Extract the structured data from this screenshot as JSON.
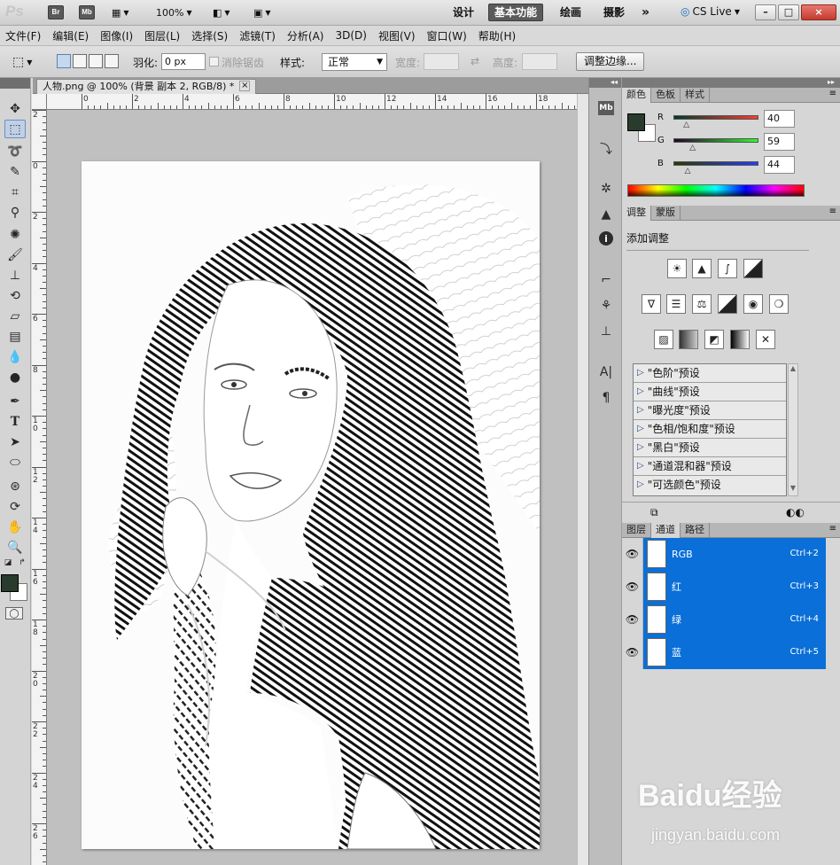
{
  "appbar": {
    "logo": "Ps",
    "badges": [
      "Br",
      "Mb"
    ],
    "zoom": "100%",
    "workspaces": [
      "设计",
      "基本功能",
      "绘画",
      "摄影"
    ],
    "active_workspace": "基本功能",
    "more": "»",
    "cslive": "CS Live",
    "window_buttons": [
      "–",
      "□",
      "×"
    ]
  },
  "menubar": [
    "文件(F)",
    "编辑(E)",
    "图像(I)",
    "图层(L)",
    "选择(S)",
    "滤镜(T)",
    "分析(A)",
    "3D(D)",
    "视图(V)",
    "窗口(W)",
    "帮助(H)"
  ],
  "options": {
    "feather_label": "羽化:",
    "feather_value": "0 px",
    "antialias_label": "消除锯齿",
    "style_label": "样式:",
    "style_value": "正常",
    "width_label": "宽度:",
    "height_label": "高度:",
    "refine_button": "调整边缘..."
  },
  "document": {
    "tab_title": "人物.png @ 100% (背景 副本 2, RGB/8) *",
    "ruler_h_labels": [
      "0",
      "2",
      "4",
      "6",
      "8",
      "10",
      "12",
      "14",
      "16",
      "18"
    ],
    "ruler_v_labels": [
      "2",
      "0",
      "2",
      "4",
      "6",
      "8",
      "1\n0",
      "1\n2",
      "1\n4",
      "1\n6",
      "1\n8",
      "2\n0",
      "2\n2",
      "2\n4",
      "2\n6"
    ]
  },
  "color_panel": {
    "tabs": [
      "颜色",
      "色板",
      "样式"
    ],
    "r_label": "R",
    "g_label": "G",
    "b_label": "B",
    "r": "40",
    "g": "59",
    "b": "44",
    "r_fraction": 0.157,
    "g_fraction": 0.231,
    "b_fraction": 0.173,
    "fg_color": "#283b2c",
    "bg_color": "#ffffff"
  },
  "adjust_panel": {
    "tabs": [
      "调整",
      "蒙版"
    ],
    "title": "添加调整",
    "presets": [
      "\"色阶\"预设",
      "\"曲线\"预设",
      "\"曝光度\"预设",
      "\"色相/饱和度\"预设",
      "\"黑白\"预设",
      "\"通道混和器\"预设",
      "\"可选颜色\"预设"
    ]
  },
  "channels_panel": {
    "tabs": [
      "图层",
      "通道",
      "路径"
    ],
    "rows": [
      {
        "name": "RGB",
        "shortcut": "Ctrl+2"
      },
      {
        "name": "红",
        "shortcut": "Ctrl+3"
      },
      {
        "name": "绿",
        "shortcut": "Ctrl+4"
      },
      {
        "name": "蓝",
        "shortcut": "Ctrl+5"
      }
    ],
    "selection_color": "#0a6fd8"
  },
  "watermark": {
    "brand": "Baidu经验",
    "url": "jingyan.baidu.com"
  }
}
